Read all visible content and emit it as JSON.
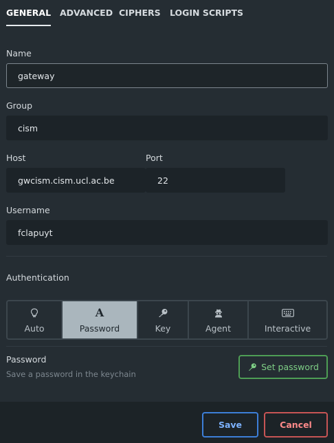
{
  "tabs": [
    {
      "label": "GENERAL",
      "active": true
    },
    {
      "label": "ADVANCED",
      "active": false
    },
    {
      "label": "CIPHERS",
      "active": false
    },
    {
      "label": "LOGIN SCRIPTS",
      "active": false
    }
  ],
  "fields": {
    "name": {
      "label": "Name",
      "value": "gateway"
    },
    "group": {
      "label": "Group",
      "value": "cism"
    },
    "host": {
      "label": "Host",
      "value": "gwcism.cism.ucl.ac.be"
    },
    "port": {
      "label": "Port",
      "value": "22"
    },
    "username": {
      "label": "Username",
      "value": "fclapuyt"
    }
  },
  "authentication": {
    "label": "Authentication",
    "selected": "Password",
    "options": [
      {
        "label": "Auto",
        "icon": "lightbulb-icon"
      },
      {
        "label": "Password",
        "icon": "letter-a-icon",
        "glyph": "A"
      },
      {
        "label": "Key",
        "icon": "key-icon"
      },
      {
        "label": "Agent",
        "icon": "agent-icon"
      },
      {
        "label": "Interactive",
        "icon": "keyboard-icon"
      }
    ]
  },
  "password": {
    "label": "Password",
    "hint": "Save a password in the keychain",
    "button_label": "Set password",
    "button_icon": "key-icon"
  },
  "footer": {
    "save_label": "Save",
    "cancel_label": "Cancel"
  },
  "colors": {
    "background": "#252d33",
    "input_bg": "#1c2328",
    "active_segment": "#aab6bd",
    "set_password_accent": "#4e9e55",
    "save_accent": "#3d7fd8",
    "cancel_accent": "#c85555"
  }
}
